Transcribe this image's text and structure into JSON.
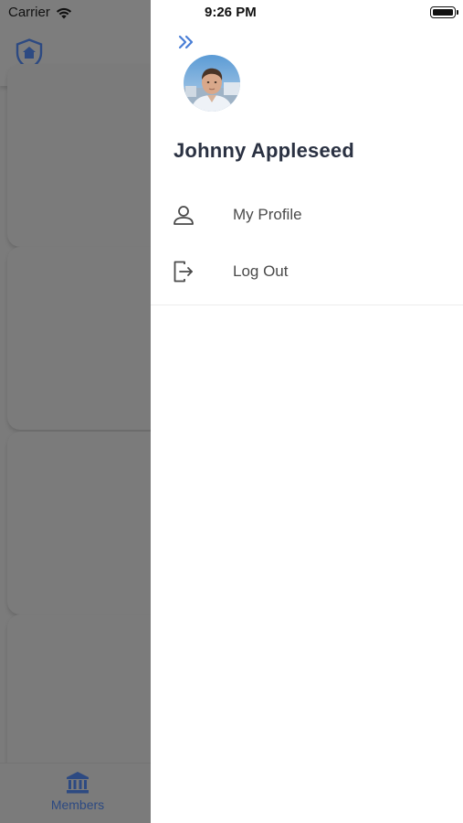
{
  "status_bar": {
    "carrier": "Carrier",
    "time": "9:26 PM"
  },
  "background": {
    "logo_icon": "shield-home-icon",
    "tab_bar": {
      "tabs": [
        {
          "label": "Members",
          "icon": "bank-icon",
          "active": true
        }
      ]
    }
  },
  "drawer": {
    "collapse_icon": "double-chevron-right-icon",
    "user": {
      "name": "Johnny Appleseed",
      "avatar_icon": "user-avatar-photo"
    },
    "menu": [
      {
        "label": "My Profile",
        "icon": "person-icon"
      },
      {
        "label": "Log Out",
        "icon": "logout-icon"
      }
    ]
  },
  "colors": {
    "accent": "#4a7fd6",
    "brand_dark": "#2d4a82",
    "name_text": "#2a3142",
    "menu_text": "#4a4a4a",
    "overlay": "#7b7b7b"
  }
}
